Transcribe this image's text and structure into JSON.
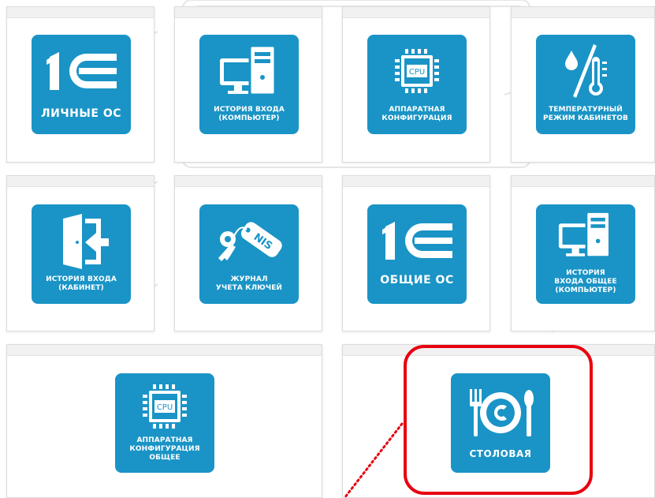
{
  "colors": {
    "tile_bg": "#1a94c6",
    "highlight": "#e8000f",
    "card_header": "#f1f1f1"
  },
  "tiles": [
    {
      "label": "ЛИЧНЫЕ ОС",
      "icon": "1c-logo-icon"
    },
    {
      "label": "ИСТОРИЯ ВХОДА\n(КОМПЬЮТЕР)",
      "icon": "computer-icon"
    },
    {
      "label": "АППАРАТНАЯ\nКОНФИГУРАЦИЯ",
      "icon": "cpu-chip-icon",
      "chip_text": "CPU"
    },
    {
      "label": "ТЕМПЕРАТУРНЫЙ\nРЕЖИМ КАБИНЕТОВ",
      "icon": "thermometer-icon"
    },
    {
      "label": "ИСТОРИЯ ВХОДА\n(КАБИНЕТ)",
      "icon": "door-enter-icon"
    },
    {
      "label": "ЖУРНАЛ\nУЧЕТА КЛЮЧЕЙ",
      "icon": "key-tag-icon",
      "tag_text": "NIS"
    },
    {
      "label": "ОБЩИЕ ОС",
      "icon": "1c-logo-icon"
    },
    {
      "label": "ИСТОРИЯ\nВХОДА ОБЩЕЕ\n(КОМПЬЮТЕР)",
      "icon": "computer-icon"
    },
    {
      "label": "АППАРАТНАЯ\nКОНФИГУРАЦИЯ\nОБЩЕЕ",
      "icon": "cpu-chip-icon",
      "chip_text": "CPU"
    },
    {
      "label": "СТОЛОВАЯ",
      "icon": "plate-cutlery-icon"
    }
  ]
}
